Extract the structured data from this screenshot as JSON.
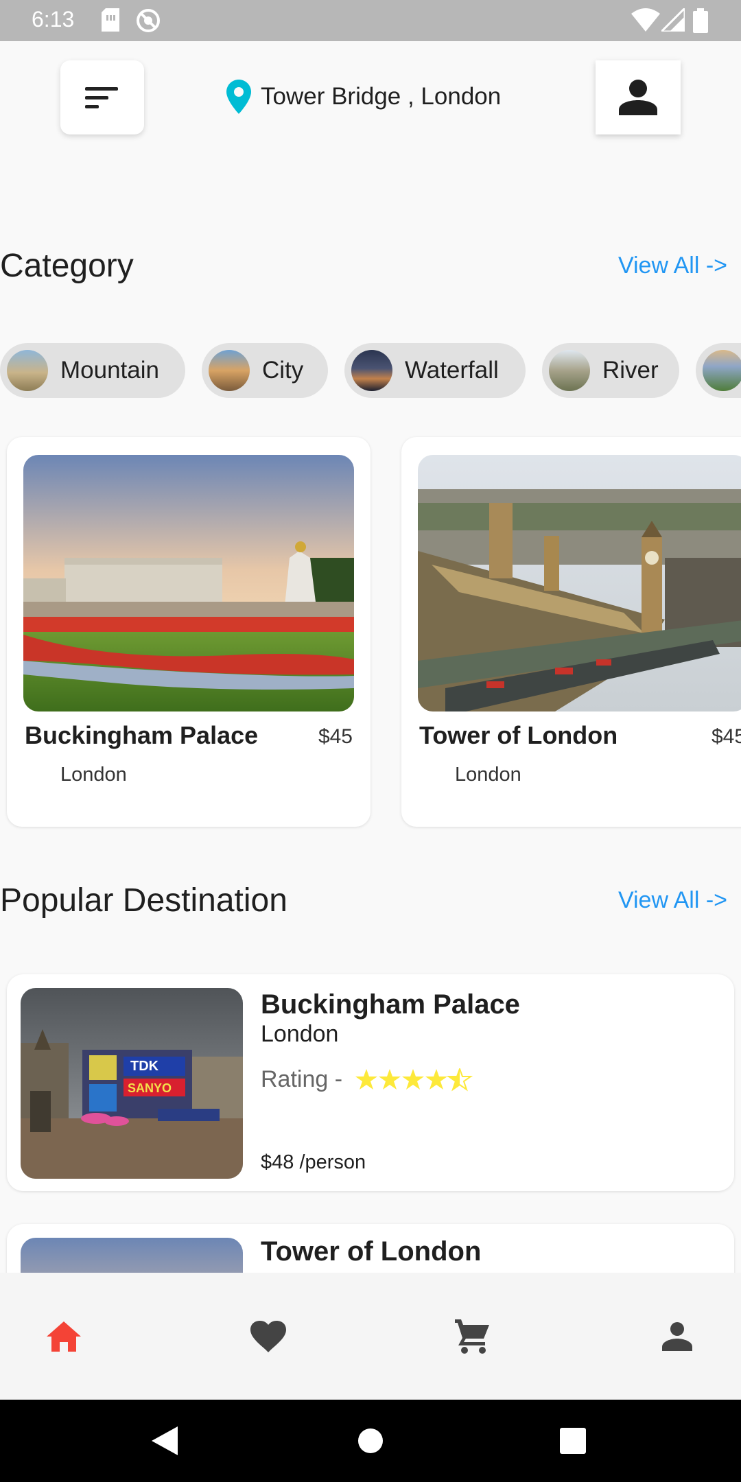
{
  "status_bar": {
    "time": "6:13"
  },
  "header": {
    "location": "Tower Bridge , London"
  },
  "category_section": {
    "title": "Category",
    "view_all": "View All ->",
    "chips": [
      {
        "label": "Mountain"
      },
      {
        "label": "City"
      },
      {
        "label": "Waterfall"
      },
      {
        "label": "River"
      },
      {
        "label": ""
      }
    ]
  },
  "featured": [
    {
      "name": "Buckingham Palace",
      "price": "$45",
      "city": "London"
    },
    {
      "name": "Tower of London",
      "price": "$45",
      "city": "London"
    }
  ],
  "popular_section": {
    "title": "Popular Destination",
    "view_all": "View All ->",
    "items": [
      {
        "name": "Buckingham Palace",
        "city": "London",
        "rating_label": "Rating -",
        "rating": 4.5,
        "price": "$48 /person"
      },
      {
        "name": "Tower of London"
      }
    ]
  },
  "colors": {
    "accent": "#2196f3",
    "active_nav": "#f44336",
    "star": "#fde93a",
    "pin": "#00bcd4"
  },
  "bottom_nav": [
    {
      "icon": "home-icon",
      "active": true
    },
    {
      "icon": "heart-icon",
      "active": false
    },
    {
      "icon": "cart-icon",
      "active": false
    },
    {
      "icon": "person-icon",
      "active": false
    }
  ]
}
